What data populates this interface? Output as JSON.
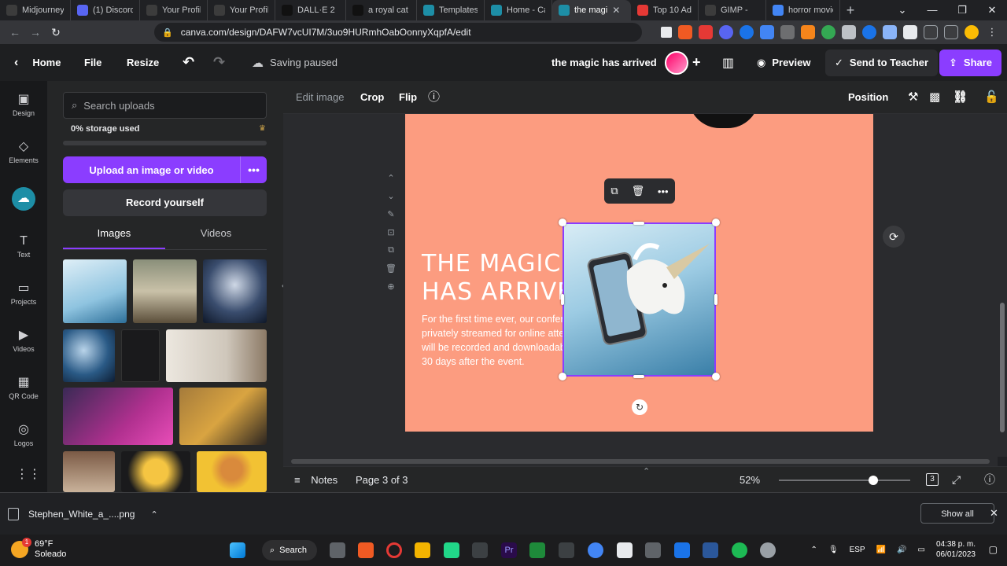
{
  "browser": {
    "tabs": [
      {
        "title": "Midjourney",
        "color": "#3c3c3c"
      },
      {
        "title": "(1) Discord |",
        "color": "#5865f2"
      },
      {
        "title": "Your Profile",
        "color": "#3c3c3c"
      },
      {
        "title": "Your Profile",
        "color": "#3c3c3c"
      },
      {
        "title": "DALL·E 2",
        "color": "#111111"
      },
      {
        "title": "a royal cat ri",
        "color": "#111111"
      },
      {
        "title": "Templates",
        "color": "#1d8ea6"
      },
      {
        "title": "Home - Canv",
        "color": "#1d8ea6"
      },
      {
        "title": "the magi",
        "color": "#1d8ea6"
      },
      {
        "title": "Top 10 Adob",
        "color": "#e53935"
      },
      {
        "title": "GIMP - ",
        "color": "#3c3c3c"
      },
      {
        "title": "horror movie",
        "color": "#4285f4"
      }
    ],
    "url": "canva.com/design/DAFW7vcUI7M/3uo9HURmhOabOonnyXqpfA/edit"
  },
  "topbar": {
    "home": "Home",
    "file": "File",
    "resize": "Resize",
    "saving": "Saving paused",
    "design_title": "the magic has arrived",
    "preview": "Preview",
    "send": "Send to Teacher",
    "share": "Share"
  },
  "rail": [
    {
      "label": "Design",
      "icon": "▣"
    },
    {
      "label": "Elements",
      "icon": "◇"
    },
    {
      "label": "",
      "icon": "☁"
    },
    {
      "label": "Text",
      "icon": "T"
    },
    {
      "label": "Projects",
      "icon": "▭"
    },
    {
      "label": "Videos",
      "icon": "▶"
    },
    {
      "label": "QR Code",
      "icon": "▦"
    },
    {
      "label": "Logos",
      "icon": "◎"
    },
    {
      "label": "",
      "icon": "⋮⋮"
    }
  ],
  "panel": {
    "search_placeholder": "Search uploads",
    "storage": "0% storage used",
    "upload": "Upload an image or video",
    "record": "Record yourself",
    "tab_images": "Images",
    "tab_videos": "Videos"
  },
  "ctxbar": {
    "edit_image": "Edit image",
    "crop": "Crop",
    "flip": "Flip",
    "position": "Position"
  },
  "canvas": {
    "heading_line1": "THE MAGIC",
    "heading_line2": "HAS ARRIVED",
    "paragraph": "For the first time ever, our conference will be privately streamed for online attendees. All talks will be recorded and downloadable to attendees 30 days after the event.",
    "page_color": "#fc9c80"
  },
  "bottombar": {
    "notes": "Notes",
    "page": "Page 3 of 3",
    "zoom": "52%",
    "zoom_fraction": 0.52,
    "pages_count": "3"
  },
  "shelf": {
    "file": "Stephen_White_a_....png",
    "show_all": "Show all"
  },
  "taskbar": {
    "temp": "69°F",
    "weather": "Soleado",
    "badge": "1",
    "search": "Search",
    "lang": "ESP",
    "time": "04:38 p. m.",
    "date": "06/01/2023"
  }
}
